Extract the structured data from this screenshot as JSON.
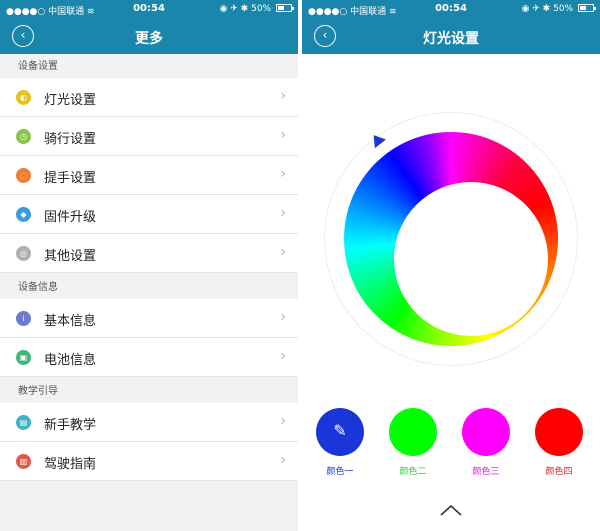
{
  "status_bar": {
    "carrier": "●●●●○ 中国联通",
    "wifi_icon": "wifi-icon",
    "time": "00:54",
    "right_icons": "◉ ✈ ✱",
    "battery_percent": "50%"
  },
  "left_screen": {
    "title": "更多",
    "back_label": "‹",
    "sections": [
      {
        "header": "设备设置",
        "items": [
          {
            "label": "灯光设置",
            "icon": "bulb-icon",
            "color": "#e8c21e",
            "glyph": "◐"
          },
          {
            "label": "骑行设置",
            "icon": "clock-icon",
            "color": "#8bc34a",
            "glyph": "◷"
          },
          {
            "label": "提手设置",
            "icon": "handle-icon",
            "color": "#f07c30",
            "glyph": "◌"
          },
          {
            "label": "固件升级",
            "icon": "upgrade-icon",
            "color": "#3c9be0",
            "glyph": "◆"
          },
          {
            "label": "其他设置",
            "icon": "settings-icon",
            "color": "#b0b0b0",
            "glyph": "◎"
          }
        ]
      },
      {
        "header": "设备信息",
        "items": [
          {
            "label": "基本信息",
            "icon": "info-icon",
            "color": "#6a7bd0",
            "glyph": "i"
          },
          {
            "label": "电池信息",
            "icon": "battery-info-icon",
            "color": "#3cb878",
            "glyph": "▣"
          }
        ]
      },
      {
        "header": "教学引导",
        "items": [
          {
            "label": "新手教学",
            "icon": "book-icon",
            "color": "#3cb5c8",
            "glyph": "▤"
          },
          {
            "label": "驾驶指南",
            "icon": "guide-icon",
            "color": "#e05a4a",
            "glyph": "▥"
          }
        ]
      }
    ]
  },
  "right_screen": {
    "title": "灯光设置",
    "back_label": "‹",
    "selector_angle_deg": -38,
    "swatches": [
      {
        "label": "颜色一",
        "color": "#1a35d8",
        "label_color": "#1a35d8",
        "selected": true
      },
      {
        "label": "颜色二",
        "color": "#00ff00",
        "label_color": "#33cc33",
        "selected": false
      },
      {
        "label": "颜色三",
        "color": "#ff00ff",
        "label_color": "#e020e0",
        "selected": false
      },
      {
        "label": "颜色四",
        "color": "#ff0000",
        "label_color": "#e02020",
        "selected": false
      }
    ],
    "pencil_glyph": "✎",
    "accent": "#1b86ac"
  }
}
